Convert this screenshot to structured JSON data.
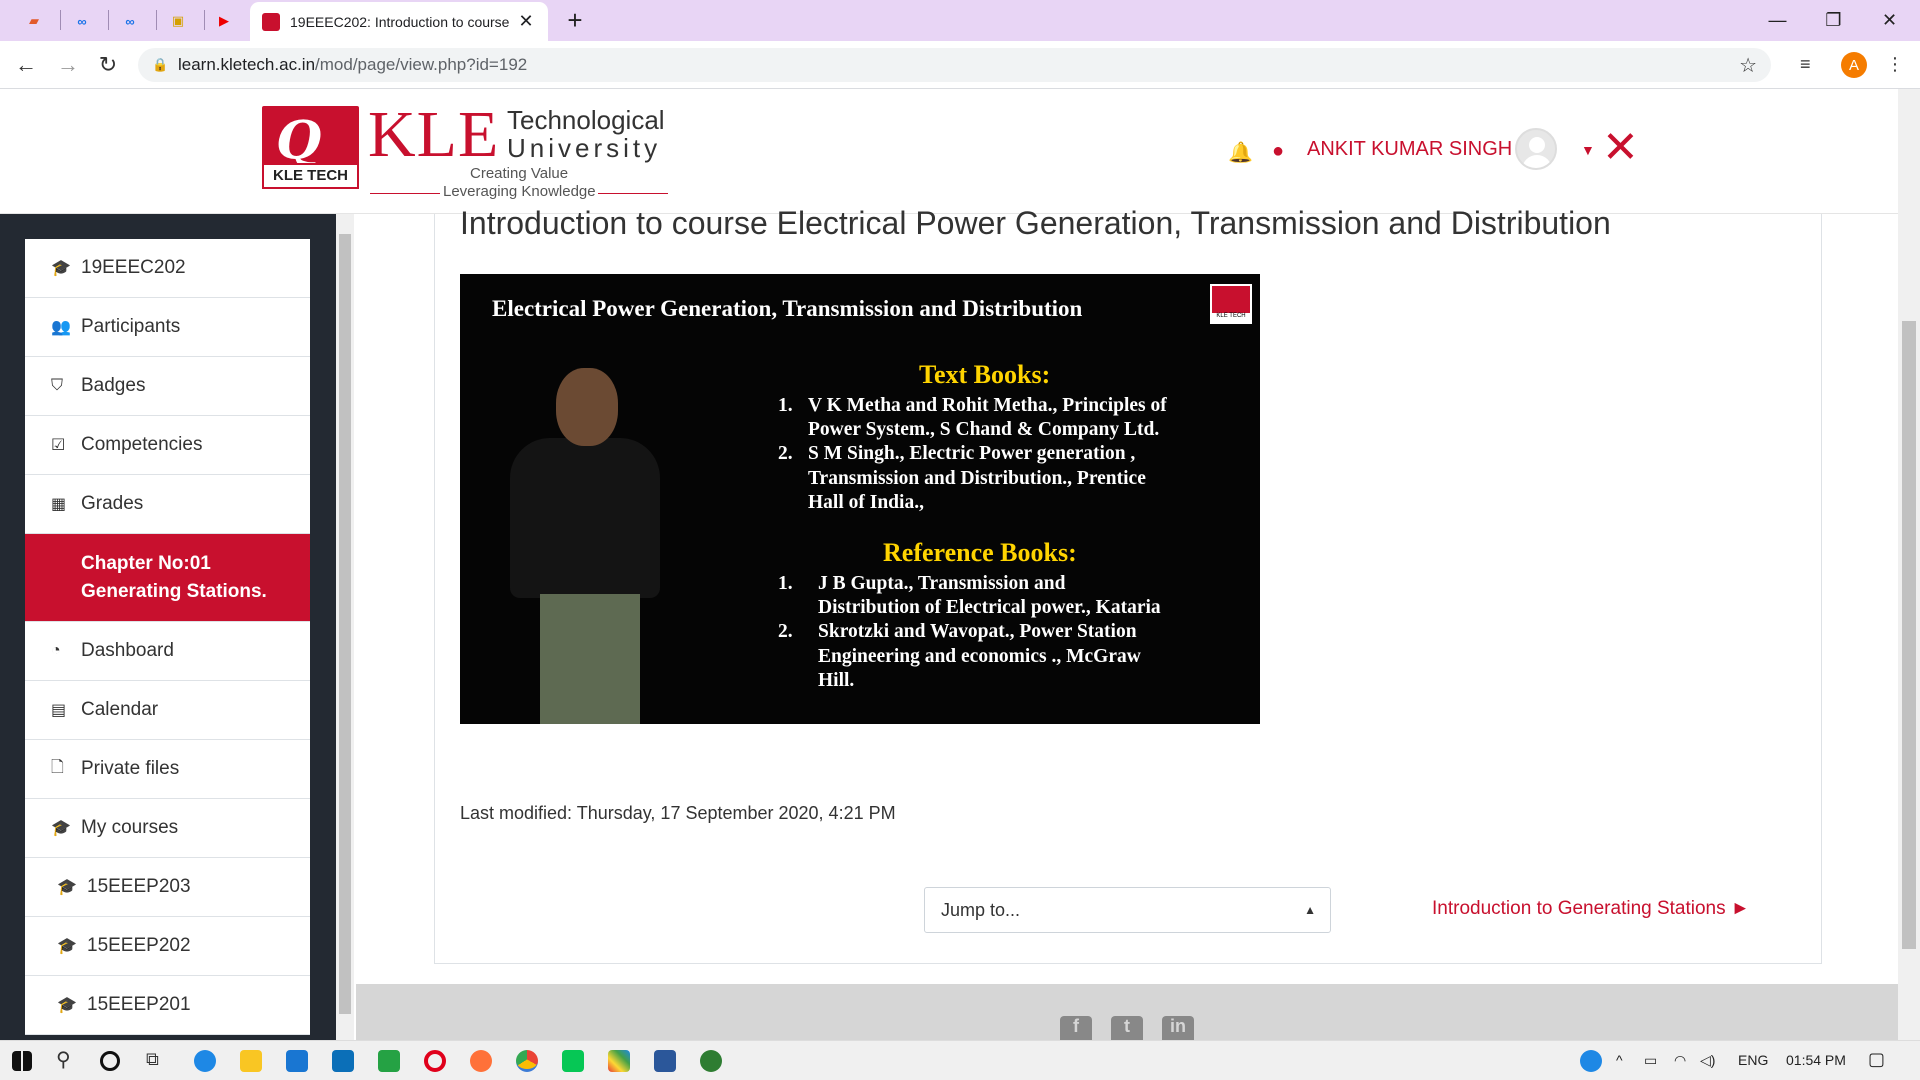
{
  "browser": {
    "active_tab_title": "19EEEC202: Introduction to course",
    "url_host": "learn.kletech.ac.in",
    "url_path": "/mod/page/view.php?id=192",
    "profile_initial": "A",
    "new_tab": "+",
    "window_controls": {
      "minimize": "—",
      "maximize": "❐",
      "close": "✕"
    }
  },
  "header": {
    "logo_badge": "KLE TECH",
    "logo_kle": "KLE",
    "logo_technological": "Technological",
    "logo_university": "University",
    "tagline_1": "Creating Value",
    "tagline_2": "Leveraging Knowledge",
    "user_name": "ANKIT KUMAR SINGH .",
    "icons": [
      "bell-icon",
      "chat-icon",
      "close-icon"
    ]
  },
  "sidebar": {
    "items": [
      {
        "label": "19EEEC202",
        "icon": "graduation-cap-icon"
      },
      {
        "label": "Participants",
        "icon": "users-icon"
      },
      {
        "label": "Badges",
        "icon": "shield-icon"
      },
      {
        "label": "Competencies",
        "icon": "checkbox-icon"
      },
      {
        "label": "Grades",
        "icon": "table-icon"
      }
    ],
    "active_line1": "Chapter No:01",
    "active_line2": "Generating Stations.",
    "items2": [
      {
        "label": "Dashboard",
        "icon": "dashboard-icon"
      },
      {
        "label": "Calendar",
        "icon": "calendar-icon"
      },
      {
        "label": "Private files",
        "icon": "file-icon"
      },
      {
        "label": "My courses",
        "icon": "graduation-cap-icon"
      },
      {
        "label": "15EEEP203",
        "icon": "graduation-cap-icon"
      },
      {
        "label": "15EEEP202",
        "icon": "graduation-cap-icon"
      },
      {
        "label": "15EEEP201",
        "icon": "graduation-cap-icon"
      }
    ]
  },
  "main": {
    "title": "Introduction to course Electrical Power Generation, Transmission and Distribution",
    "video": {
      "title": "Electrical Power Generation, Transmission and Distribution",
      "logo_text": "KLE TECH",
      "text_books_heading": "Text Books:",
      "tb1_num": "1.",
      "tb1_l1": "V K Metha and Rohit Metha., Principles of",
      "tb1_l2": "Power System., S Chand & Company Ltd.",
      "tb2_num": "2.",
      "tb2_l1": "S M Singh., Electric Power generation ,",
      "tb2_l2": "Transmission and Distribution., Prentice",
      "tb2_l3": "Hall of India.,",
      "ref_heading": "Reference Books:",
      "rb1_num": "1.",
      "rb1_l1": "J B Gupta., Transmission and",
      "rb1_l2": "Distribution of Electrical power., Kataria",
      "rb2_num": "2.",
      "rb2_l1": "Skrotzki and Wavopat., Power Station",
      "rb2_l2": "Engineering and economics ., McGraw",
      "rb2_l3": "Hill."
    },
    "last_modified": "Last modified: Thursday, 17 September 2020, 4:21 PM",
    "jump_placeholder": "Jump to...",
    "next_link": "Introduction to Generating Stations ►"
  },
  "taskbar": {
    "lang": "ENG",
    "time": "01:54 PM"
  }
}
